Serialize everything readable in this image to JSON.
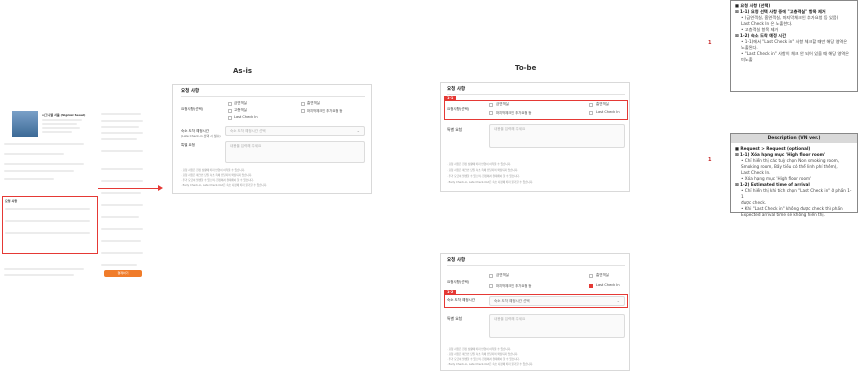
{
  "labels": {
    "asis": "As-is",
    "tobe": "To-be"
  },
  "asis": {
    "title": "요청 사항",
    "row1_label": "요청사항(선택)",
    "opt1": "금연객실",
    "opt2": "흡연객실",
    "opt3": "고층객실",
    "opt4": "마지막체크인 추가요청 등",
    "opt5": "Last Check In",
    "row2_label": "숙소 도착 예정시간",
    "row2_sub": "(Late Check-in 선택 시 필수)",
    "row2_select": "숙소 도착 예정시간 선택",
    "row3_label": "특별 요청",
    "row3_placeholder": "내용을 입력해 주세요",
    "notes": [
      "· 요청 사항은 현장 상황에 따라 반영이 어려울 수 있습니다.",
      "· 요청 사항은 체크인 당일 숙소 측에 전달되며 확정되지 않습니다.",
      "· 추가 요금이 발생할 수 있으며, 현장에서 결제해야 할 수 있습니다.",
      "· Early Check-in, Late Check-Out은 숙소 사정에 따라 불가할 수 있습니다."
    ]
  },
  "tobe1": {
    "title": "요청 사항",
    "tag": "1-1",
    "row1_label": "요청사항(선택)",
    "opt1": "금연객실",
    "opt2": "흡연객실",
    "opt3": "마지막체크인 추가요청 등",
    "opt4": "Last Check In",
    "row3_label": "특별 요청",
    "row3_placeholder": "내용을 입력해 주세요",
    "notes": [
      "· 요청 사항은 현장 상황에 따라 반영이 어려울 수 있습니다.",
      "· 요청 사항은 체크인 당일 숙소 측에 전달되며 확정되지 않습니다.",
      "· 추가 요금이 발생할 수 있으며, 현장에서 결제해야 할 수 있습니다.",
      "· Early Check-in, Late Check-Out은 숙소 사정에 따라 불가할 수 있습니다."
    ]
  },
  "tobe2": {
    "title": "요청 사항",
    "tag": "1-2",
    "row1_label": "요청사항(선택)",
    "opt1": "금연객실",
    "opt2": "흡연객실",
    "opt3": "마지막체크인 추가요청 등",
    "opt4": "Last Check In",
    "row2_label": "숙소 도착 예정시간",
    "row2_select": "숙소 도착 예정시간 선택",
    "row3_label": "특별 요청",
    "row3_placeholder": "내용을 입력해 주세요",
    "notes": [
      "· 요청 사항은 현장 상황에 따라 반영이 어려울 수 있습니다.",
      "· 요청 사항은 체크인 당일 숙소 측에 전달되며 확정되지 않습니다.",
      "· 추가 요금이 발생할 수 있으며, 현장에서 결제해야 할 수 있습니다.",
      "· Early Check-in, Late Check-Out은 숙소 사정에 따라 불가할 수 있습니다."
    ]
  },
  "annotation_kr": {
    "number": "1",
    "header": "■ 요청 사항 (선택)",
    "h1": "⊠ 1-1) 요청 선택 사항 중에 \"고층객실\" 항목 제거",
    "b1a": "• (금연객실, 흡연객실, 마지막체크인 추가요청 등 있음)",
    "b1b": "  Last Check In 은 노출한다.",
    "b1c": "• 고층객실 항목 제거",
    "h2": "⊠ 1-2) 숙소 도착 예정 시간",
    "b2a": "• 1-1)에서 \"Last Check in\" 사항 체크할 때만 해당 영역은",
    "b2b": "  노출된다.",
    "b2c": "• \"Last Check in\" 사항이 체크 안 되어 있을 때 해당 영역은",
    "b2d": "  미노출"
  },
  "annotation_vn": {
    "number": "1",
    "header": "Description (VN ver.)",
    "h0": "■ Request > Request (optional)",
    "h1": "⊠ 1-1) Xóa hạng mục 'High floor room'",
    "b1a": "• Chỉ hiển thị các tuỳ chọn Non smoking room,",
    "b1b": "  Smoking room, Bấy tiều có thể linh phí thêm),",
    "b1c": "  Last Check In.",
    "b1d": "• Xóa hạng mục 'High floor room'",
    "h2": "⊠ 1-2) Estimated time of arrival",
    "b2a": "• Chỉ hiển thị khi tích chọn \"Last Check in\" ở phần 1-1",
    "b2b": "  được check.",
    "b2c": "• Khi \"Last Check in\" không được check thì phần",
    "b2d": "  Expected arrival time sẽ không hiển thị."
  },
  "left_thumb": {
    "hotel": "시그니엘 서울 (Signiel Seoul)",
    "request_title": "요청 사항",
    "btn": "결제하기"
  }
}
